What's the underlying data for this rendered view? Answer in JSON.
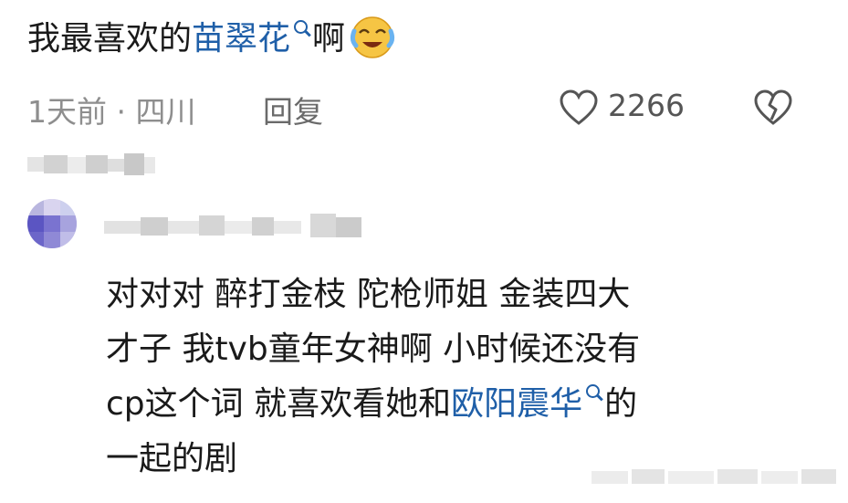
{
  "comment": {
    "text_prefix": "我最喜欢的",
    "link_text": "苗翠花",
    "text_suffix": "啊",
    "emoji_icon": "crying-laughing-face-icon"
  },
  "meta": {
    "time_location": "1天前 · 四川",
    "reply_label": "回复",
    "like_count": "2266",
    "like_icon": "heart-outline-icon",
    "dislike_icon": "broken-heart-icon"
  },
  "reply": {
    "line1": "对对对 醉打金枝 陀枪师姐 金装四大",
    "line2": "才子 我tvb童年女神啊  小时候还没有",
    "line3_prefix": "cp这个词 就喜欢看她和",
    "line3_link": "欧阳震华",
    "line3_suffix": "的",
    "line4": "一起的剧"
  },
  "colors": {
    "link": "#1f5fa8",
    "meta_gray": "#8e8e8e",
    "text": "#1a1a1a"
  }
}
